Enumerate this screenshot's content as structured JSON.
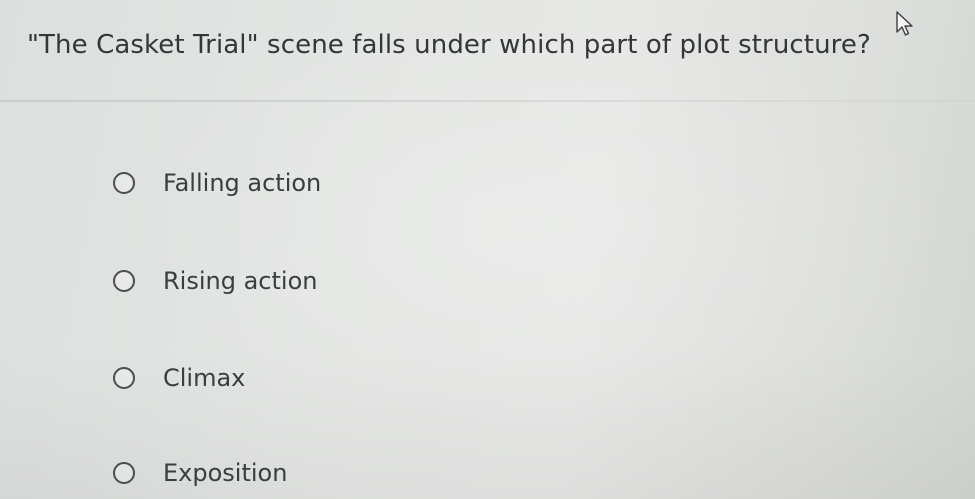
{
  "question": {
    "text": "\"The Casket Trial\" scene falls under which part of plot structure?"
  },
  "options": [
    {
      "label": "Falling action",
      "selected": false
    },
    {
      "label": "Rising action",
      "selected": false
    },
    {
      "label": "Climax",
      "selected": false
    },
    {
      "label": "Exposition",
      "selected": false
    }
  ],
  "cursor": {
    "icon": "mouse-pointer-icon"
  }
}
